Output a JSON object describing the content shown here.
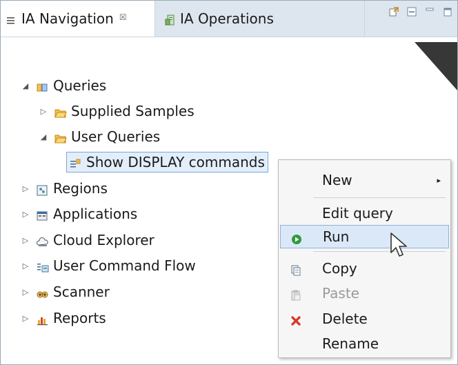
{
  "tabs": [
    {
      "label": "IA Navigation",
      "close": "☒",
      "icon": "navigation-list-icon"
    },
    {
      "label": "IA Operations",
      "icon": "operations-icon"
    }
  ],
  "view_tools": [
    "sync-icon",
    "collapse-all-icon",
    "minimize-icon",
    "maximize-icon"
  ],
  "tree": {
    "items": [
      {
        "label": "Queries",
        "icon": "queries-icon",
        "twisty": "◢"
      },
      {
        "label": "Supplied Samples",
        "icon": "folder-icon",
        "twisty": "▷"
      },
      {
        "label": "User Queries",
        "icon": "folder-icon",
        "twisty": "◢"
      },
      {
        "label": "Show DISPLAY commands",
        "icon": "query-icon",
        "twisty": ""
      },
      {
        "label": "Regions",
        "icon": "regions-icon",
        "twisty": "▷"
      },
      {
        "label": "Applications",
        "icon": "applications-icon",
        "twisty": "▷"
      },
      {
        "label": "Cloud Explorer",
        "icon": "cloud-explorer-icon",
        "twisty": "▷"
      },
      {
        "label": "User Command Flow",
        "icon": "command-flow-icon",
        "twisty": "▷"
      },
      {
        "label": "Scanner",
        "icon": "scanner-icon",
        "twisty": "▷"
      },
      {
        "label": "Reports",
        "icon": "reports-icon",
        "twisty": "▷"
      }
    ]
  },
  "context_menu": {
    "new": "New",
    "edit_query": "Edit query",
    "run": "Run",
    "copy": "Copy",
    "paste": "Paste",
    "delete": "Delete",
    "rename": "Rename",
    "submenu_arrow": "▸"
  },
  "colors": {
    "selection": "#e3eefb",
    "folder": "#e8a53a",
    "run_green": "#2e9a3c",
    "delete_red": "#d83a2e",
    "watermark": "#2c2c2c"
  }
}
